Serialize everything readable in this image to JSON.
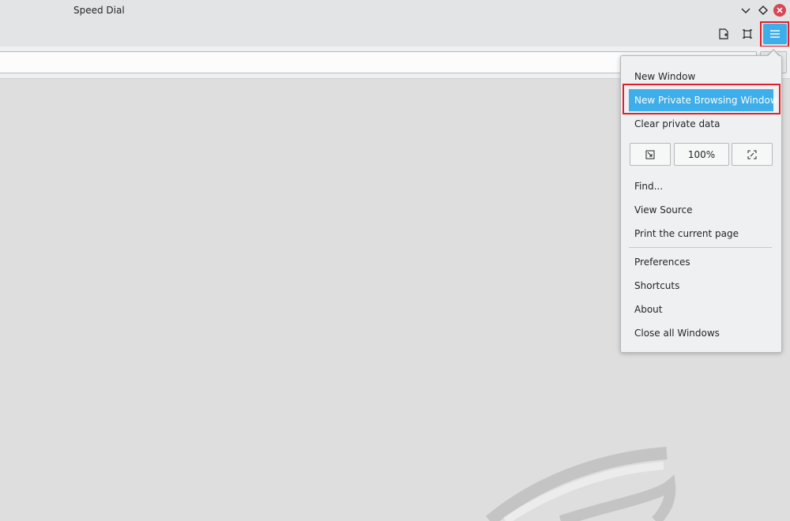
{
  "window": {
    "title": "Speed Dial"
  },
  "menu": {
    "items_top": [
      {
        "label": "New Window",
        "selected": false
      },
      {
        "label": "New Private Browsing Window",
        "selected": true
      },
      {
        "label": "Clear private data",
        "selected": false
      }
    ],
    "zoom_level": "100%",
    "items_mid": [
      {
        "label": "Find..."
      },
      {
        "label": "View Source"
      },
      {
        "label": "Print the current page"
      }
    ],
    "items_bottom": [
      {
        "label": "Preferences"
      },
      {
        "label": "Shortcuts"
      },
      {
        "label": "About"
      },
      {
        "label": "Close all Windows"
      }
    ]
  },
  "colors": {
    "accent": "#3daee9",
    "highlight_box": "#e0202a",
    "close_button": "#da4453"
  },
  "icons": {
    "minimize": "chevron-down-icon",
    "maximize": "diamond-icon",
    "close": "close-icon",
    "bookmark": "bookmark-page-icon",
    "fullscreen": "fullscreen-icon",
    "menu": "hamburger-menu-icon",
    "zoom_out": "zoom-out-icon",
    "zoom_in": "zoom-in-icon"
  }
}
